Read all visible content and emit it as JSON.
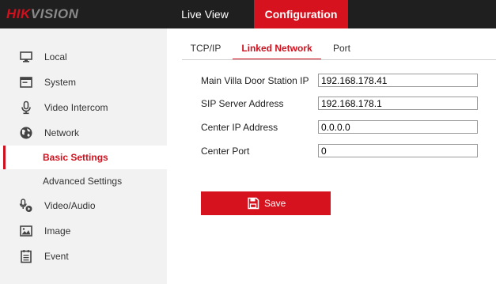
{
  "header": {
    "logo_hik": "HIK",
    "logo_vision": "VISION",
    "nav_live_view": "Live View",
    "nav_configuration": "Configuration"
  },
  "sidebar": {
    "items": [
      {
        "label": "Local",
        "icon": "monitor-icon"
      },
      {
        "label": "System",
        "icon": "system-window-icon"
      },
      {
        "label": "Video Intercom",
        "icon": "microphone-icon"
      },
      {
        "label": "Network",
        "icon": "globe-icon"
      },
      {
        "label": "Basic Settings",
        "active": true
      },
      {
        "label": "Advanced Settings"
      },
      {
        "label": "Video/Audio",
        "icon": "video-audio-icon"
      },
      {
        "label": "Image",
        "icon": "image-icon"
      },
      {
        "label": "Event",
        "icon": "event-list-icon"
      }
    ]
  },
  "tabs": {
    "tcpip": "TCP/IP",
    "linked_network": "Linked Network",
    "port": "Port",
    "active": "Linked Network"
  },
  "form": {
    "main_villa_door_station_ip": {
      "label": "Main Villa Door Station IP",
      "value": "192.168.178.41"
    },
    "sip_server_address": {
      "label": "SIP Server Address",
      "value": "192.168.178.1"
    },
    "center_ip_address": {
      "label": "Center IP Address",
      "value": "0.0.0.0"
    },
    "center_port": {
      "label": "Center Port",
      "value": "0"
    }
  },
  "actions": {
    "save_label": "Save",
    "save_icon": "floppy-disk-icon"
  },
  "colors": {
    "accent": "#d6121e",
    "topbar": "#1f1f1f",
    "sidebar": "#f2f2f2"
  }
}
